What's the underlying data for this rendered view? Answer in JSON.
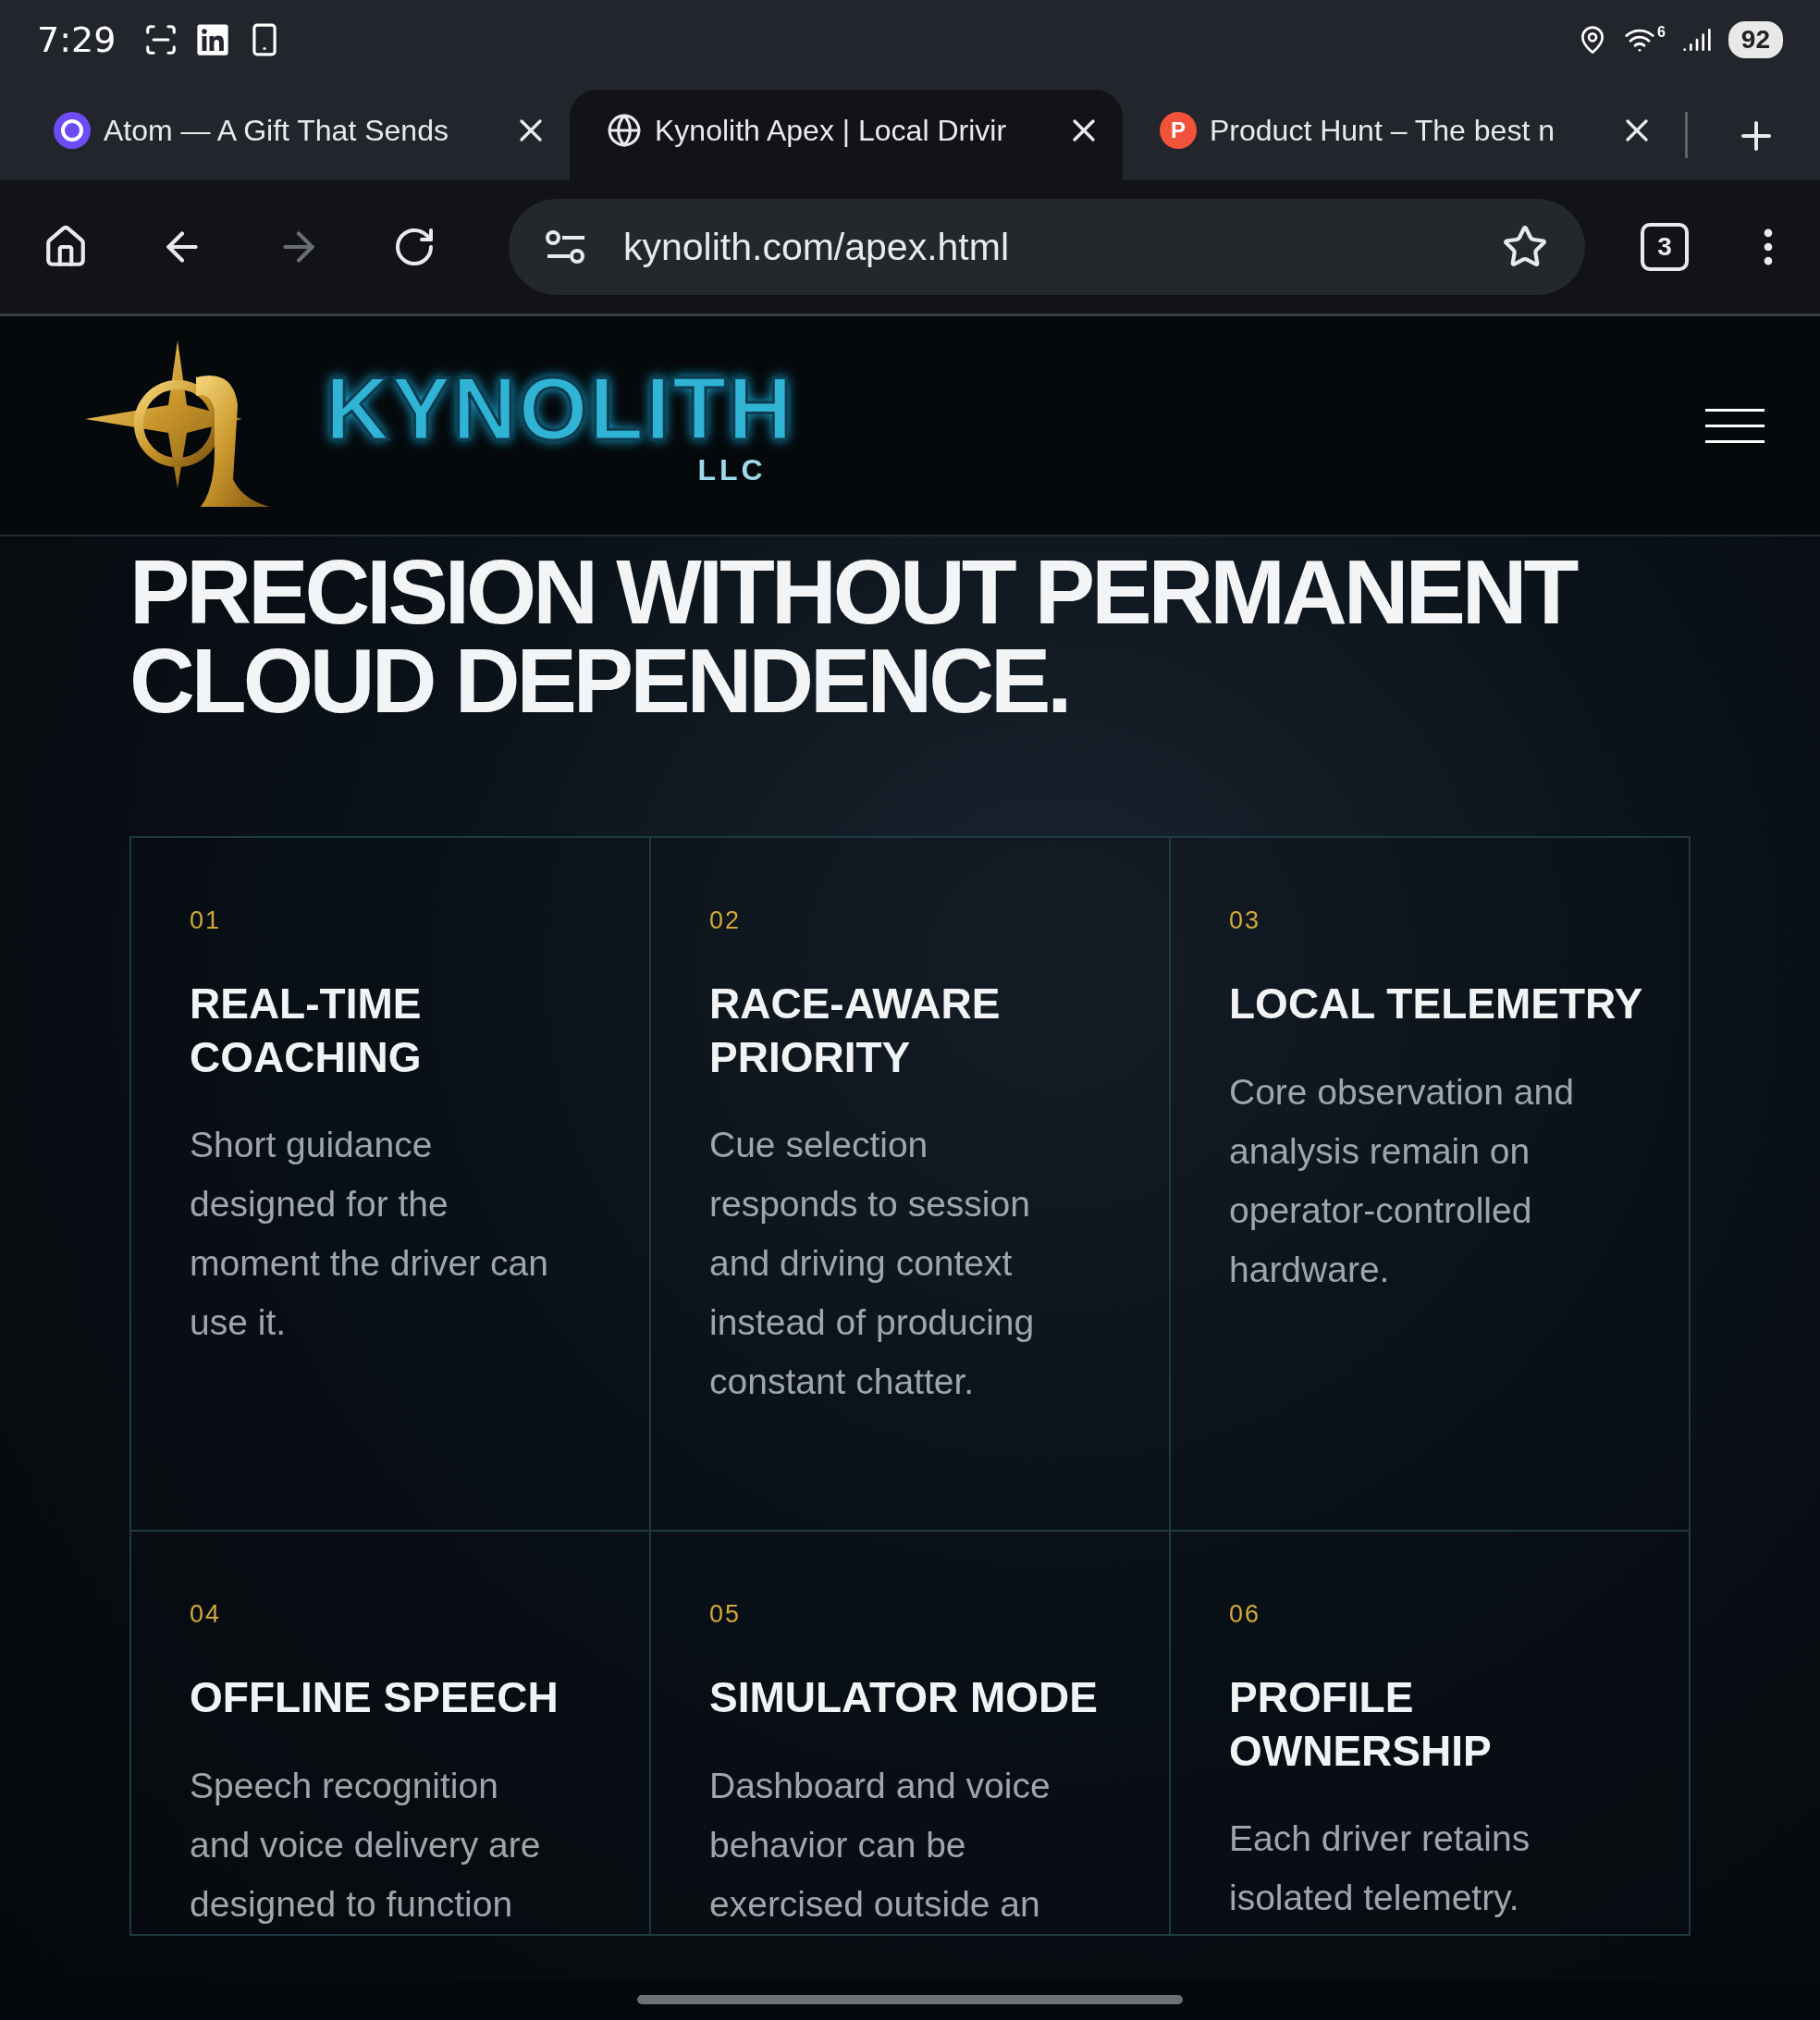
{
  "status_bar": {
    "time": "7:29",
    "wifi_badge": "6",
    "battery": "92"
  },
  "tabs": [
    {
      "title": "Atom — A Gift That Sends",
      "kind": "atom",
      "selected": false
    },
    {
      "title": "Kynolith Apex | Local Drivir",
      "kind": "globe",
      "selected": true
    },
    {
      "title": "Product Hunt – The best n",
      "kind": "producthunt",
      "favicon_text": "P",
      "selected": false
    }
  ],
  "toolbar": {
    "url": "kynolith.com/apex.html",
    "tab_count": "3"
  },
  "site_header": {
    "wordmark": "KYNOLITH",
    "wordmark_sub": "LLC"
  },
  "headline": "PRECISION WITHOUT PERMANENT CLOUD DEPENDENCE.",
  "features": [
    {
      "number": "01",
      "title": "REAL-TIME COACHING",
      "body": "Short guidance designed for the moment the driver can use it."
    },
    {
      "number": "02",
      "title": "RACE-AWARE PRIORITY",
      "body": "Cue selection responds to session and driving context instead of producing constant chatter."
    },
    {
      "number": "03",
      "title": "LOCAL TELEMETRY",
      "body": "Core observation and analysis remain on operator-controlled hardware."
    },
    {
      "number": "04",
      "title": "OFFLINE SPEECH",
      "body": "Speech recognition and voice delivery are designed to function"
    },
    {
      "number": "05",
      "title": "SIMULATOR MODE",
      "body": "Dashboard and voice behavior can be exercised outside an"
    },
    {
      "number": "06",
      "title": "PROFILE OWNERSHIP",
      "body": "Each driver retains isolated telemetry."
    }
  ]
}
